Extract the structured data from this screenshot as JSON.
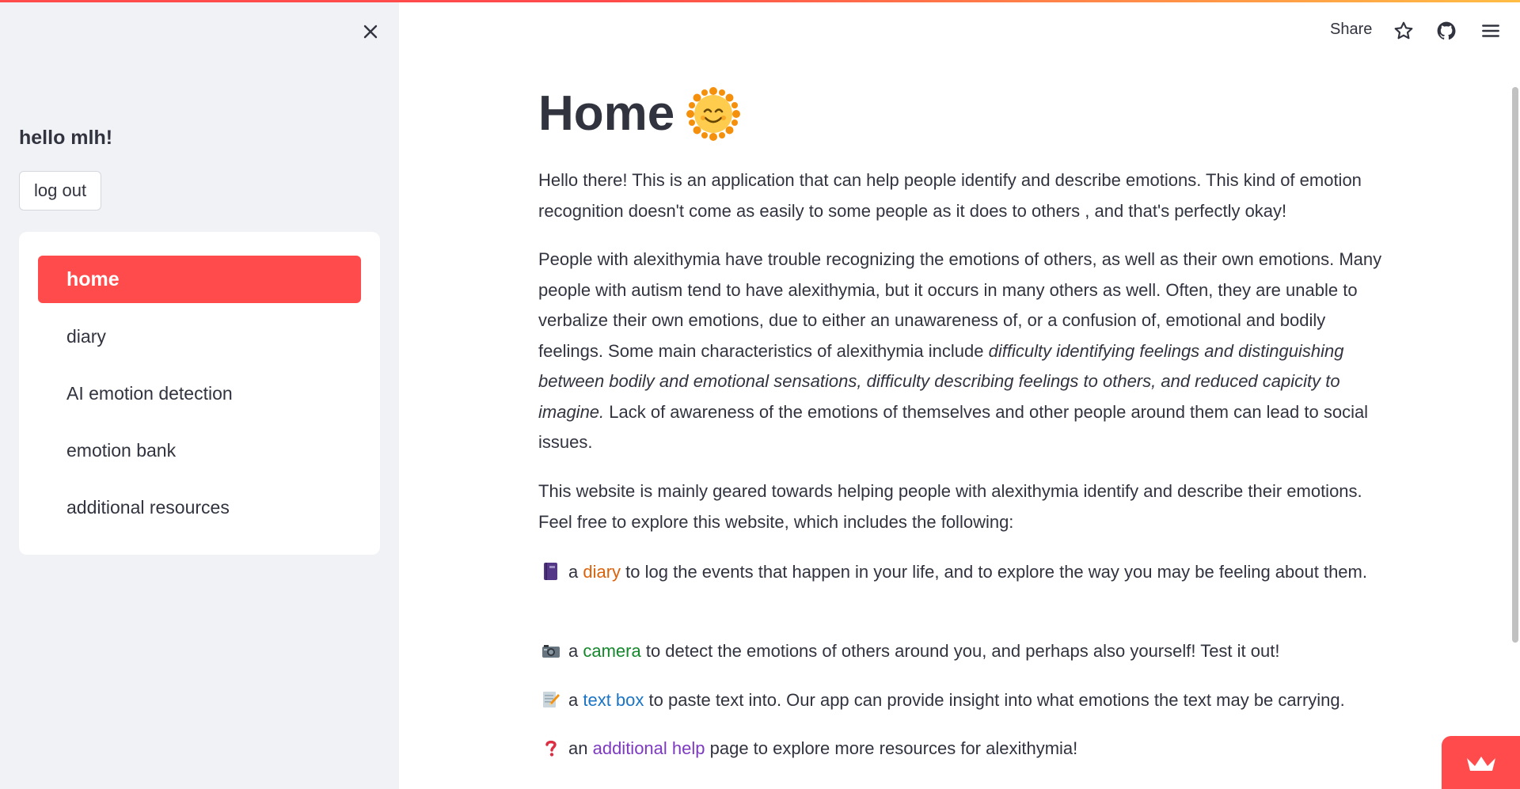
{
  "sidebar": {
    "greeting": "hello mlh!",
    "logout_label": "log out",
    "nav_items": [
      {
        "label": "home",
        "active": true
      },
      {
        "label": "diary",
        "active": false
      },
      {
        "label": "AI emotion detection",
        "active": false
      },
      {
        "label": "emotion bank",
        "active": false
      },
      {
        "label": "additional resources",
        "active": false
      }
    ]
  },
  "header": {
    "share_label": "Share",
    "icons": [
      "star-icon",
      "github-icon",
      "hamburger-menu-icon"
    ]
  },
  "main": {
    "title": "Home",
    "title_icon": "smiling-sun-icon",
    "para1": "Hello there! This is an application that can help people identify and describe emotions. This kind of emotion recognition doesn't come as easily to some people as it does to others , and that's perfectly okay!",
    "para2_start": "People with alexithymia have trouble recognizing the emotions of others, as well as their own emotions. Many people with autism tend to have alexithymia, but it occurs in many others as well. Often, they are unable to verbalize their own emotions, due to either an unawareness of, or a confusion of, emotional and bodily feelings. Some main characteristics of alexithymia include ",
    "para2_italic": "difficulty identifying feelings and distinguishing between bodily and emotional sensations, difficulty describing feelings to others, and reduced capicity to imagine.",
    "para2_end": " Lack of awareness of the emotions of themselves and other people around them can lead to social issues.",
    "para3": "This website is mainly geared towards helping people with alexithymia identify and describe their emotions. Feel free to explore this website, which includes the following:",
    "features": [
      {
        "icon": "notebook-icon",
        "prefix": "a ",
        "link": "diary",
        "color": "#d9630c",
        "rest": " to log the events that happen in your life, and to explore the way you may be feeling about them."
      },
      {
        "icon": "camera-icon",
        "prefix": "a ",
        "link": "camera",
        "color": "#15872c",
        "rest": " to detect the emotions of others around you, and perhaps also yourself! Test it out!"
      },
      {
        "icon": "memo-icon",
        "prefix": "a ",
        "link": "text box",
        "color": "#1b74c4",
        "rest": " to paste text into. Our app can provide insight into what emotions the text may be carrying."
      },
      {
        "icon": "question-mark-icon",
        "prefix": "an ",
        "link": "additional help",
        "color": "#7d3ac1",
        "rest": " page to explore more resources for alexithymia!"
      }
    ]
  },
  "colors": {
    "accent": "#ff4b4b",
    "sidebar_bg": "#f0f2f6",
    "text": "#31333f"
  }
}
